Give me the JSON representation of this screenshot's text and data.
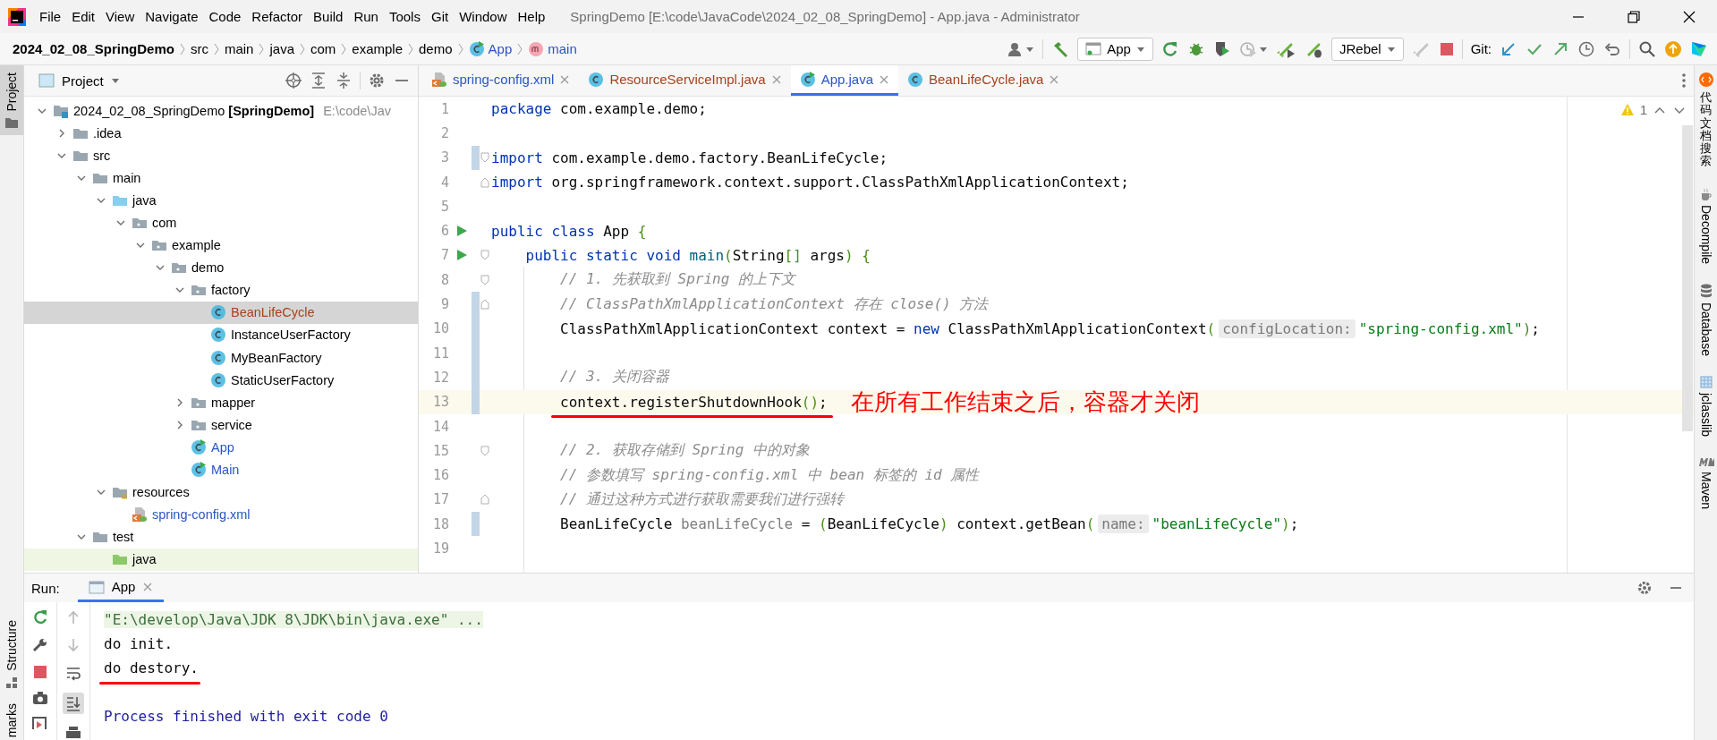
{
  "window": {
    "title": "SpringDemo [E:\\code\\JavaCode\\2024_02_08_SpringDemo] - App.java - Administrator"
  },
  "menu": [
    "File",
    "Edit",
    "View",
    "Navigate",
    "Code",
    "Refactor",
    "Build",
    "Run",
    "Tools",
    "Git",
    "Window",
    "Help"
  ],
  "breadcrumbs": [
    {
      "label": "2024_02_08_SpringDemo",
      "kind": "project"
    },
    {
      "label": "src",
      "kind": "folder"
    },
    {
      "label": "main",
      "kind": "folder"
    },
    {
      "label": "java",
      "kind": "folder"
    },
    {
      "label": "com",
      "kind": "folder"
    },
    {
      "label": "example",
      "kind": "folder"
    },
    {
      "label": "demo",
      "kind": "folder"
    },
    {
      "label": "App",
      "kind": "class"
    },
    {
      "label": "main",
      "kind": "method"
    }
  ],
  "toolbar": {
    "run_config": "App",
    "jrebel": "JRebel",
    "git_label": "Git:"
  },
  "left_strip": [
    {
      "label": "Project",
      "selected": true
    },
    {
      "label": "Structure",
      "selected": false
    },
    {
      "label": "marks",
      "selected": false
    }
  ],
  "project_panel": {
    "title": "Project",
    "tree": [
      {
        "label": "2024_02_08_SpringDemo **[SpringDemo]**",
        "path": "E:\\code\\Jav",
        "kind": "module",
        "selected": false,
        "expanded": true,
        "children": [
          {
            "label": ".idea",
            "kind": "folder",
            "selected": false,
            "expanded": false
          },
          {
            "label": "src",
            "kind": "folder",
            "selected": false,
            "expanded": true,
            "children": [
              {
                "label": "main",
                "kind": "folder",
                "selected": false,
                "expanded": true,
                "children": [
                  {
                    "label": "java",
                    "kind": "source",
                    "selected": false,
                    "expanded": true,
                    "children": [
                      {
                        "label": "com",
                        "kind": "package",
                        "selected": false,
                        "expanded": true,
                        "children": [
                          {
                            "label": "example",
                            "kind": "package",
                            "selected": false,
                            "expanded": true,
                            "children": [
                              {
                                "label": "demo",
                                "kind": "package",
                                "selected": false,
                                "expanded": true,
                                "children": [
                                  {
                                    "label": "factory",
                                    "kind": "package",
                                    "selected": false,
                                    "expanded": true,
                                    "children": [
                                      {
                                        "label": "BeanLifeCycle",
                                        "kind": "class",
                                        "color": "#a4431e",
                                        "selected": true
                                      },
                                      {
                                        "label": "InstanceUserFactory",
                                        "kind": "class",
                                        "selected": false
                                      },
                                      {
                                        "label": "MyBeanFactory",
                                        "kind": "class",
                                        "selected": false
                                      },
                                      {
                                        "label": "StaticUserFactory",
                                        "kind": "class",
                                        "selected": false
                                      }
                                    ]
                                  },
                                  {
                                    "label": "mapper",
                                    "kind": "package",
                                    "selected": false,
                                    "expanded": false
                                  },
                                  {
                                    "label": "service",
                                    "kind": "package",
                                    "selected": false,
                                    "expanded": false
                                  },
                                  {
                                    "label": "App",
                                    "kind": "runnable",
                                    "color": "#2a55c8",
                                    "selected": false
                                  },
                                  {
                                    "label": "Main",
                                    "kind": "runnable",
                                    "color": "#2a55c8",
                                    "selected": false
                                  }
                                ]
                              }
                            ]
                          }
                        ]
                      }
                    ]
                  },
                  {
                    "label": "resources",
                    "kind": "resources",
                    "selected": false,
                    "expanded": true,
                    "children": [
                      {
                        "label": "spring-config.xml",
                        "kind": "xml",
                        "color": "#2a55c8",
                        "selected": false
                      }
                    ]
                  }
                ]
              },
              {
                "label": "test",
                "kind": "folder",
                "selected": false,
                "expanded": true,
                "children": [
                  {
                    "label": "java",
                    "kind": "test-source",
                    "selected": false
                  }
                ]
              }
            ]
          }
        ]
      }
    ]
  },
  "editor": {
    "tabs": [
      {
        "label": "spring-config.xml",
        "kind": "xml",
        "color": "#2a55c8",
        "selected": false
      },
      {
        "label": "ResourceServiceImpl.java",
        "kind": "class",
        "color": "#a4431e",
        "selected": false
      },
      {
        "label": "App.java",
        "kind": "runnable",
        "color": "#2a55c8",
        "selected": true
      },
      {
        "label": "BeanLifeCycle.java",
        "kind": "class",
        "color": "#a4431e",
        "selected": false
      }
    ],
    "warnings": "1",
    "lines": [
      {
        "number": "1",
        "fold_start": false,
        "fold_end": false,
        "run": false,
        "changed": false,
        "current": false,
        "tokens": [
          {
            "kind": "kw",
            "text": "package"
          },
          {
            "kind": "plain",
            "text": " com.example.demo;"
          }
        ]
      },
      {
        "number": "2",
        "fold_start": false,
        "fold_end": false,
        "run": false,
        "changed": false,
        "current": false
      },
      {
        "number": "3",
        "fold_start": true,
        "fold_end": false,
        "run": false,
        "changed": true,
        "current": false,
        "tokens": [
          {
            "kind": "kw",
            "text": "import"
          },
          {
            "kind": "plain",
            "text": " com.example.demo.factory.BeanLifeCycle;"
          }
        ]
      },
      {
        "number": "4",
        "fold_start": false,
        "fold_end": true,
        "run": false,
        "changed": false,
        "current": false,
        "tokens": [
          {
            "kind": "kw",
            "text": "import"
          },
          {
            "kind": "plain",
            "text": " org.springframework.context.support.ClassPathXmlApplicationContext;"
          }
        ]
      },
      {
        "number": "5",
        "fold_start": false,
        "fold_end": false,
        "run": false,
        "changed": false,
        "current": false
      },
      {
        "number": "6",
        "fold_start": false,
        "fold_end": false,
        "run": true,
        "changed": false,
        "current": false,
        "tokens": [
          {
            "kind": "kw",
            "text": "public class"
          },
          {
            "kind": "plain",
            "text": " App "
          },
          {
            "kind": "bracket",
            "text": "{"
          }
        ]
      },
      {
        "number": "7",
        "fold_start": true,
        "fold_end": false,
        "run": true,
        "changed": false,
        "current": false,
        "tokens": [
          {
            "kind": "kw",
            "text": "    public static void "
          },
          {
            "kind": "decl",
            "text": "main"
          },
          {
            "kind": "bracket",
            "text": "("
          },
          {
            "kind": "plain",
            "text": "String"
          },
          {
            "kind": "bracket",
            "text": "[]"
          },
          {
            "kind": "plain",
            "text": " args"
          },
          {
            "kind": "bracket",
            "text": ") {"
          }
        ]
      },
      {
        "number": "8",
        "fold_start": true,
        "fold_end": false,
        "run": false,
        "changed": false,
        "current": false,
        "tokens": [
          {
            "kind": "comment",
            "text": "        // 1. 先获取到 Spring 的上下文"
          }
        ]
      },
      {
        "number": "9",
        "fold_start": false,
        "fold_end": true,
        "run": false,
        "changed": true,
        "current": false,
        "tokens": [
          {
            "kind": "comment",
            "text": "        // ClassPathXmlApplicationContext 存在 close() 方法"
          }
        ]
      },
      {
        "number": "10",
        "fold_start": false,
        "fold_end": false,
        "run": false,
        "changed": true,
        "current": false,
        "tokens": [
          {
            "kind": "plain",
            "text": "        ClassPathXmlApplicationContext context = "
          },
          {
            "kind": "kw",
            "text": "new"
          },
          {
            "kind": "plain",
            "text": " ClassPathXmlApplicationContext"
          },
          {
            "kind": "bracket",
            "text": "("
          },
          {
            "kind": "hint",
            "text": "configLocation:"
          },
          {
            "kind": "str",
            "text": "\"spring-config.xml\""
          },
          {
            "kind": "bracket",
            "text": ")"
          },
          {
            "kind": "plain",
            "text": ";"
          }
        ]
      },
      {
        "number": "11",
        "fold_start": false,
        "fold_end": false,
        "run": false,
        "changed": true,
        "current": false
      },
      {
        "number": "12",
        "fold_start": false,
        "fold_end": false,
        "run": false,
        "changed": true,
        "current": false,
        "tokens": [
          {
            "kind": "comment",
            "text": "        // 3. 关闭容器"
          }
        ]
      },
      {
        "number": "13",
        "fold_start": false,
        "fold_end": false,
        "run": false,
        "changed": true,
        "current": true,
        "underlined": true,
        "note": "在所有工作结束之后，容器才关闭",
        "tokens": [
          {
            "kind": "plain",
            "text": "        context.registerShutdownHook"
          },
          {
            "kind": "bracket",
            "text": "()"
          },
          {
            "kind": "plain",
            "text": ";"
          }
        ]
      },
      {
        "number": "14",
        "fold_start": false,
        "fold_end": false,
        "run": false,
        "changed": false,
        "current": false
      },
      {
        "number": "15",
        "fold_start": true,
        "fold_end": false,
        "run": false,
        "changed": false,
        "current": false,
        "tokens": [
          {
            "kind": "comment",
            "text": "        // 2. 获取存储到 Spring 中的对象"
          }
        ]
      },
      {
        "number": "16",
        "fold_start": false,
        "fold_end": false,
        "run": false,
        "changed": false,
        "current": false,
        "tokens": [
          {
            "kind": "comment",
            "text": "        // 参数填写 spring-config.xml 中 bean 标签的 id 属性"
          }
        ]
      },
      {
        "number": "17",
        "fold_start": false,
        "fold_end": true,
        "run": false,
        "changed": false,
        "current": false,
        "tokens": [
          {
            "kind": "comment",
            "text": "        // 通过这种方式进行获取需要我们进行强转"
          }
        ]
      },
      {
        "number": "18",
        "fold_start": false,
        "fold_end": false,
        "run": false,
        "changed": true,
        "current": false,
        "tokens": [
          {
            "kind": "plain",
            "text": "        BeanLifeCycle "
          },
          {
            "kind": "unused",
            "text": "beanLifeCycle"
          },
          {
            "kind": "plain",
            "text": " = "
          },
          {
            "kind": "bracket",
            "text": "("
          },
          {
            "kind": "plain",
            "text": "BeanLifeCycle"
          },
          {
            "kind": "bracket",
            "text": ")"
          },
          {
            "kind": "plain",
            "text": " context.getBean"
          },
          {
            "kind": "bracket",
            "text": "("
          },
          {
            "kind": "hint",
            "text": "name:"
          },
          {
            "kind": "str",
            "text": "\"beanLifeCycle\""
          },
          {
            "kind": "bracket",
            "text": ")"
          },
          {
            "kind": "plain",
            "text": ";"
          }
        ]
      },
      {
        "number": "19",
        "fold_start": false,
        "fold_end": false,
        "run": false,
        "changed": false,
        "current": false
      }
    ]
  },
  "run_panel": {
    "label": "Run:",
    "tabs": [
      {
        "label": "App",
        "selected": true
      }
    ],
    "output": [
      {
        "kind": "command",
        "text": "\"E:\\develop\\Java\\JDK 8\\JDK\\bin\\java.exe\" ...",
        "underlined": false
      },
      {
        "kind": "stdout",
        "text": "do init.",
        "underlined": false
      },
      {
        "kind": "stdout",
        "text": "do destory.",
        "underlined": true
      },
      {
        "kind": "system",
        "text": "Process finished with exit code 0",
        "underlined": false
      }
    ]
  },
  "right_strip": [
    {
      "label": "代码文档搜索",
      "kind": "cjk"
    },
    {
      "label": "Decompile",
      "kind": "latin"
    },
    {
      "label": "Database",
      "kind": "latin"
    },
    {
      "label": "jclasslib",
      "kind": "latin"
    },
    {
      "label": "Maven",
      "kind": "latin"
    }
  ]
}
